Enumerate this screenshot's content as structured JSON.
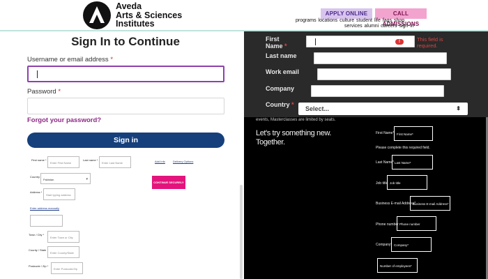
{
  "header": {
    "logo_lines": [
      "Aveda",
      "Arts & Sciences",
      "Institutes"
    ],
    "apply_label": "APPLY ONLINE",
    "call_label": "CALL ADMISSIONS",
    "nav_row1": "programs  locations  culture  student life  faqs  shop",
    "nav_row2": "services  alumni  careers  sign in"
  },
  "signin": {
    "title": "Sign In to Continue",
    "username_label": "Username or email address",
    "password_label": "Password",
    "required_mark": "*",
    "forgot_label": "Forgot your password?",
    "signin_label": "Sign in"
  },
  "checkout_form": {
    "first_name_label": "First name *",
    "first_name_placeholder": "Enter First Name",
    "last_name_label": "Last name *",
    "last_name_placeholder": "Enter Last Name",
    "country_label": "Country",
    "country_value": "Pakistan",
    "address_label": "Address *",
    "address_placeholder": "Start typing address",
    "manual_address_link": "Enter address manually",
    "town_label": "Town / City *",
    "town_placeholder": "Enter Town or City",
    "county_label": "County / State",
    "county_placeholder": "Enter County/State",
    "postcode_label": "Postcode / Zip *",
    "postcode_placeholder": "Enter Postcode/Zip",
    "side_link1": "Add Info",
    "side_link2": "Delivery Options",
    "continue_label": "CONTINUE SECURELY"
  },
  "dark_form": {
    "first_name_label_1": "First",
    "first_name_label_2": "Name",
    "last_name_label": "Last name",
    "work_email_label": "Work email",
    "company_label": "Company",
    "country_label": "Country",
    "required_mark": "*",
    "error_icon": "!",
    "error_text": "This field is required.",
    "country_placeholder": "Select...",
    "select_arrow": "⬍"
  },
  "background": {
    "event_text": "events, Masterclasses are limited by seats.",
    "tagline_1": "Let's try something new.",
    "tagline_2": "Together."
  },
  "white_form": {
    "first_name_label": "First Name*",
    "first_name_box": "First Name*",
    "required_msg": "Please complete this required field.",
    "last_name_label": "Last Name*",
    "last_name_box": "Last Name*",
    "job_title_label": "Job title",
    "job_title_box": "Job title",
    "business_email_label": "Business E-mail Address*",
    "business_email_box": "Business E-mail Address*",
    "phone_label": "Phone number",
    "phone_box": "Phone number",
    "company_label": "Company*",
    "company_box": "Company*",
    "employees_box": "Number of employees*"
  }
}
